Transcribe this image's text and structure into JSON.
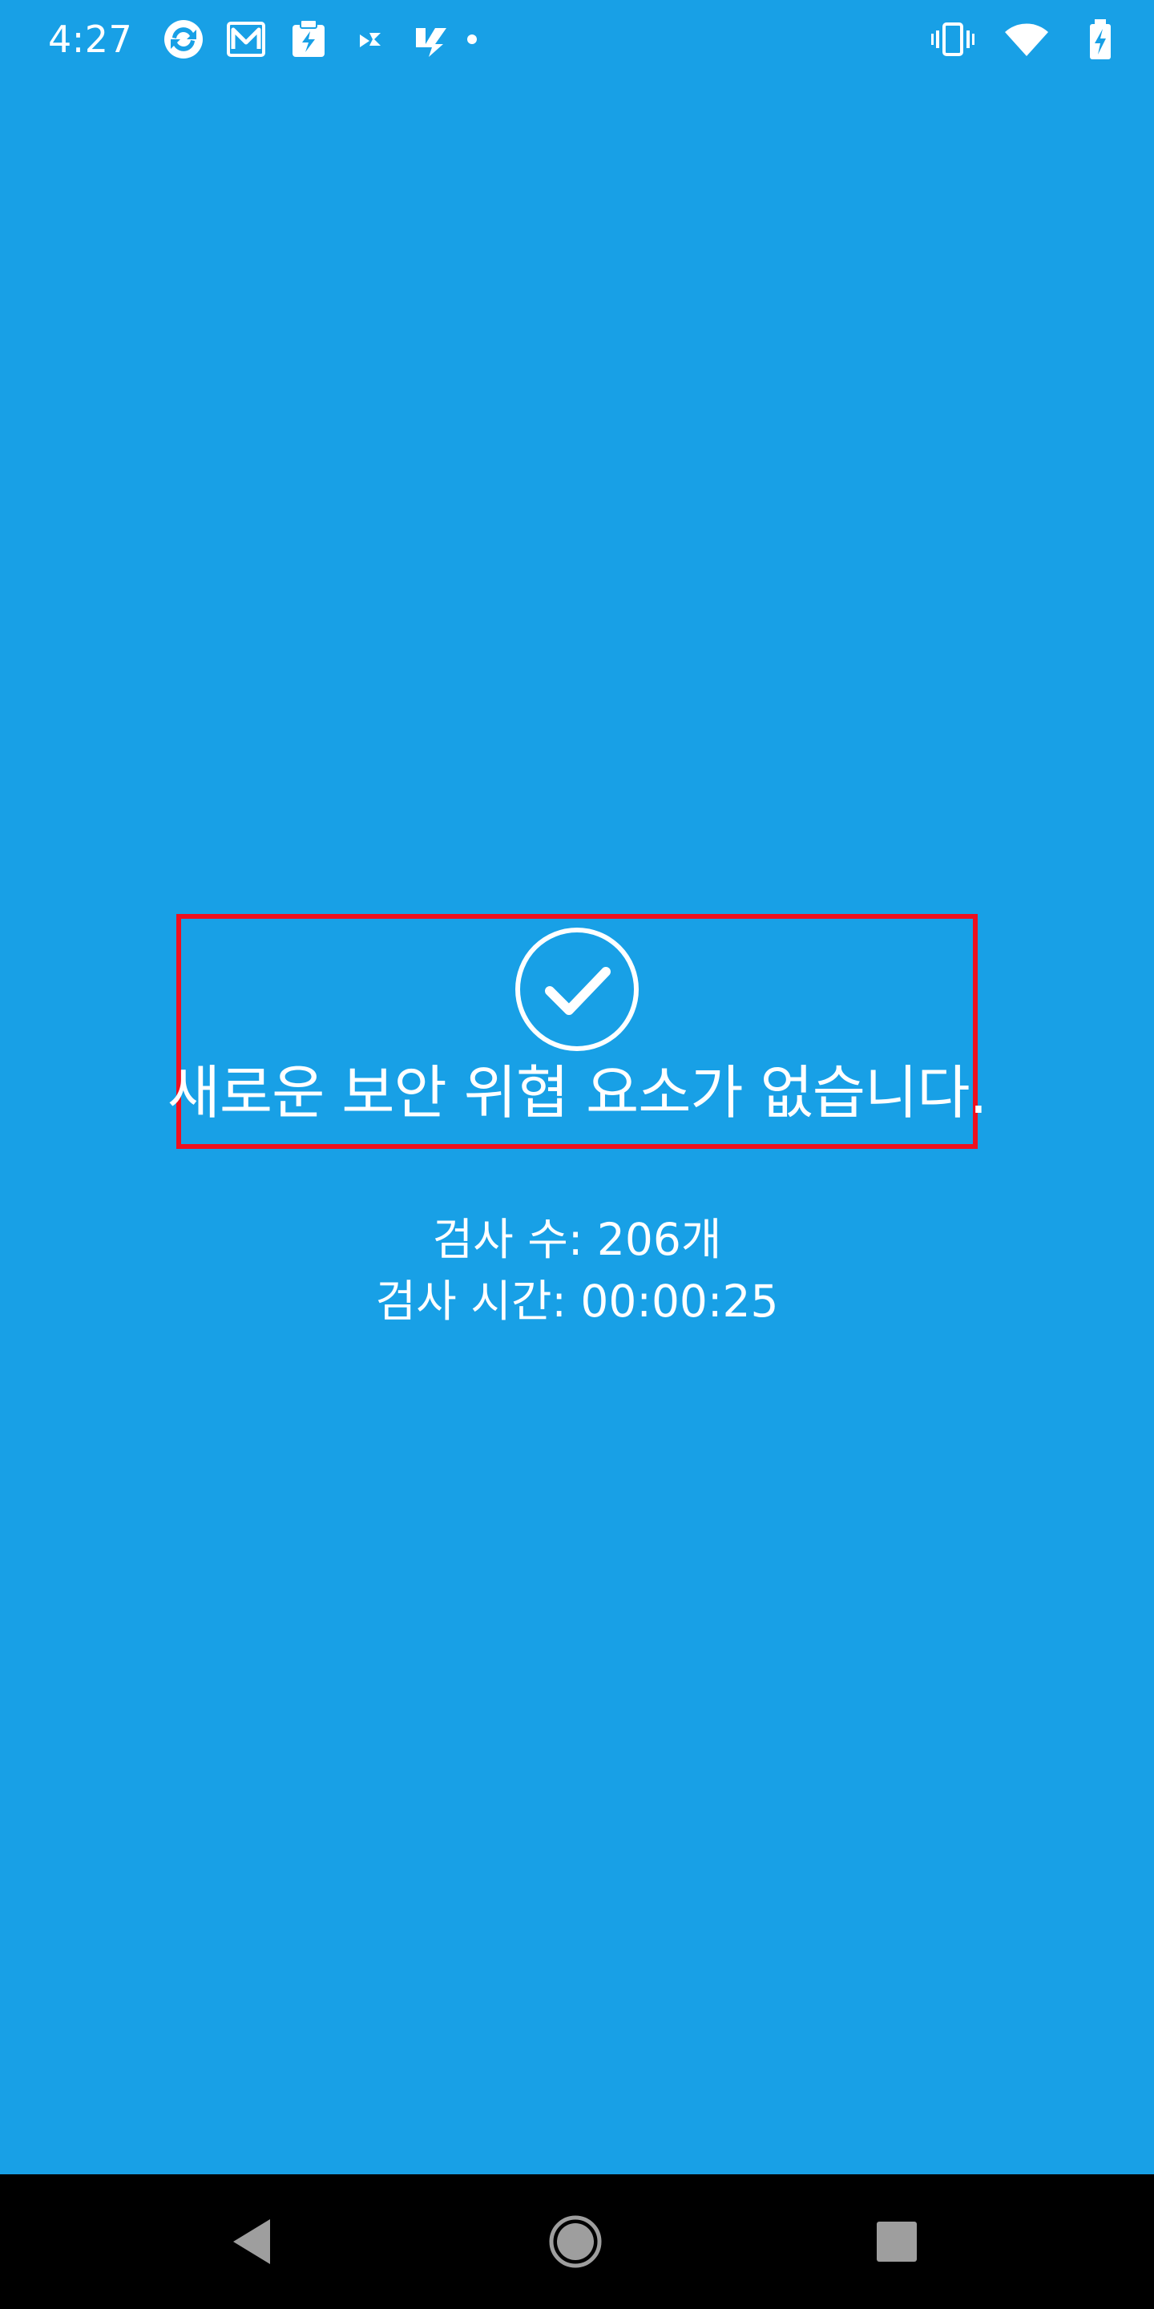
{
  "status_bar": {
    "time": "4:27",
    "notification_icons": [
      "sync-icon",
      "gallery-icon",
      "clipboard-flash-icon",
      "shuffle-icon",
      "flash-app-icon"
    ],
    "system_icons": [
      "vibrate-icon",
      "wifi-icon",
      "battery-charging-icon"
    ]
  },
  "result": {
    "icon": "check-circle-icon",
    "title": "새로운 보안 위협 요소가 없습니다."
  },
  "scan_info": {
    "count_line": "검사 수: 206개",
    "time_line": "검사 시간: 00:00:25"
  },
  "nav_bar": {
    "buttons": [
      "back-icon",
      "home-icon",
      "recents-icon"
    ]
  },
  "colors": {
    "background": "#18a0e6",
    "highlight_border": "#ee0f1e",
    "nav_background": "#000000",
    "text": "#ffffff"
  }
}
